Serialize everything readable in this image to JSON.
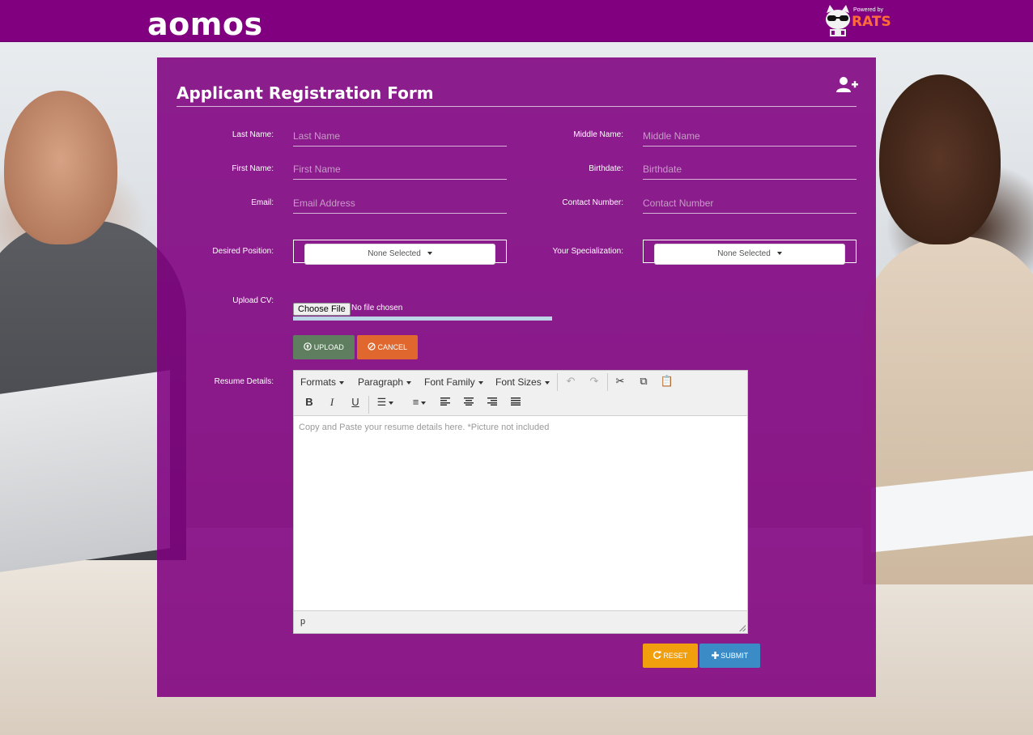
{
  "header": {
    "logo": "aomos",
    "powered_small": "Powered by",
    "powered_brand": "RATS"
  },
  "form": {
    "title": "Applicant Registration Form",
    "fields": {
      "last_name": {
        "label": "Last Name:",
        "placeholder": "Last Name"
      },
      "middle_name": {
        "label": "Middle Name:",
        "placeholder": "Middle Name"
      },
      "first_name": {
        "label": "First Name:",
        "placeholder": "First Name"
      },
      "birthdate": {
        "label": "Birthdate:",
        "placeholder": "Birthdate"
      },
      "email": {
        "label": "Email:",
        "placeholder": "Email Address"
      },
      "contact": {
        "label": "Contact Number:",
        "placeholder": "Contact Number"
      },
      "desired_position": {
        "label": "Desired Position:",
        "value": "None Selected"
      },
      "specialization": {
        "label": "Your Specialization:",
        "value": "None Selected"
      },
      "upload_cv": {
        "label": "Upload CV:",
        "choose": "Choose File",
        "status": "No file chosen"
      }
    },
    "upload_button": "UPLOAD",
    "cancel_button": "CANCEL",
    "resume": {
      "label": "Resume Details:",
      "toolbar": {
        "formats": "Formats",
        "paragraph": "Paragraph",
        "font_family": "Font Family",
        "font_sizes": "Font Sizes"
      },
      "placeholder": "Copy and Paste your resume details here. *Picture not included",
      "path": "p"
    },
    "reset_button": "RESET",
    "submit_button": "SUBMIT"
  },
  "colors": {
    "header": "#800080",
    "panel": "#800080",
    "upload": "#5f7e5f",
    "cancel": "#e0672d",
    "reset": "#f19f0d",
    "submit": "#3a8bc6"
  }
}
